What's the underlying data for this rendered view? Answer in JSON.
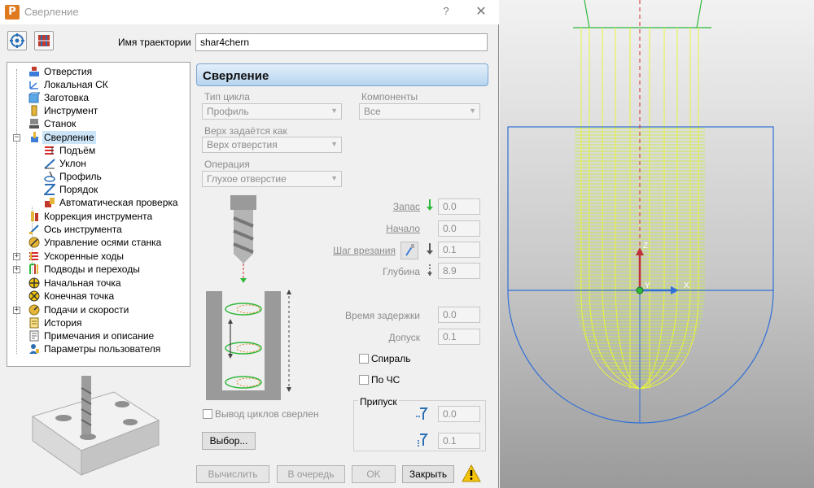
{
  "window": {
    "title": "Сверление",
    "help": "?",
    "close": "✕",
    "app_icon_letter": "P"
  },
  "trajectory": {
    "label": "Имя траектории",
    "value": "shar4chern"
  },
  "tree": {
    "items": [
      {
        "label": "Отверстия",
        "icon": "holes-icon"
      },
      {
        "label": "Локальная СК",
        "icon": "local-cs-icon"
      },
      {
        "label": "Заготовка",
        "icon": "stock-icon"
      },
      {
        "label": "Инструмент",
        "icon": "tool-icon"
      },
      {
        "label": "Станок",
        "icon": "machine-icon"
      },
      {
        "label": "Сверление",
        "icon": "drilling-icon",
        "selected": true,
        "expanded": true
      },
      {
        "label": "Подъём",
        "icon": "lift-icon"
      },
      {
        "label": "Уклон",
        "icon": "slope-icon"
      },
      {
        "label": "Профиль",
        "icon": "profile-icon"
      },
      {
        "label": "Порядок",
        "icon": "order-icon"
      },
      {
        "label": "Автоматическая проверка",
        "icon": "auto-check-icon"
      },
      {
        "label": "Коррекция инструмента",
        "icon": "tool-correction-icon"
      },
      {
        "label": "Ось инструмента",
        "icon": "tool-axis-icon"
      },
      {
        "label": "Управление осями станка",
        "icon": "axis-control-icon"
      },
      {
        "label": "Ускоренные ходы",
        "icon": "rapid-moves-icon"
      },
      {
        "label": "Подводы и переходы",
        "icon": "leads-links-icon"
      },
      {
        "label": "Начальная точка",
        "icon": "start-point-icon"
      },
      {
        "label": "Конечная точка",
        "icon": "end-point-icon"
      },
      {
        "label": "Подачи и скорости",
        "icon": "feeds-speeds-icon"
      },
      {
        "label": "История",
        "icon": "history-icon"
      },
      {
        "label": "Примечания и описание",
        "icon": "notes-icon"
      },
      {
        "label": "Параметры пользователя",
        "icon": "user-params-icon"
      }
    ]
  },
  "section": {
    "title": "Сверление"
  },
  "form": {
    "cycle_type": {
      "label": "Тип цикла",
      "value": "Профиль"
    },
    "components": {
      "label": "Компоненты",
      "value": "Все"
    },
    "top_defined": {
      "label": "Верх задаётся как",
      "value": "Верх отверстия"
    },
    "operation": {
      "label": "Операция",
      "value": "Глухое отверстие"
    },
    "clearance": {
      "label": "Запас",
      "value": "0.0"
    },
    "start": {
      "label": "Начало",
      "value": "0.0"
    },
    "peck": {
      "label": "Шаг врезания",
      "value": "0.1"
    },
    "depth": {
      "label": "Глубина",
      "value": "8.9"
    },
    "dwell": {
      "label": "Время задержки",
      "value": "0.0"
    },
    "tolerance": {
      "label": "Допуск",
      "value": "0.1"
    },
    "spiral": {
      "label": "Спираль",
      "checked": false
    },
    "clockwise": {
      "label": "По ЧС",
      "checked": false
    },
    "output_cycles": {
      "label": "Вывод циклов сверлен",
      "checked": false
    },
    "select_button": "Выбор...",
    "allowance": {
      "title": "Припуск",
      "radial": "0.0",
      "axial": "0.1"
    }
  },
  "buttons": {
    "calculate": "Вычислить",
    "queue": "В очередь",
    "ok": "OK",
    "close": "Закрыть"
  },
  "viewport": {
    "axis_x": "X",
    "axis_y": "Y",
    "axis_z": "Z"
  },
  "colors": {
    "accent": "#7fa7cf",
    "toolpath": "#e8f53a",
    "stock": "#2f6fd6",
    "tool": "#2fb83b",
    "centerline": "#d62b2b"
  }
}
